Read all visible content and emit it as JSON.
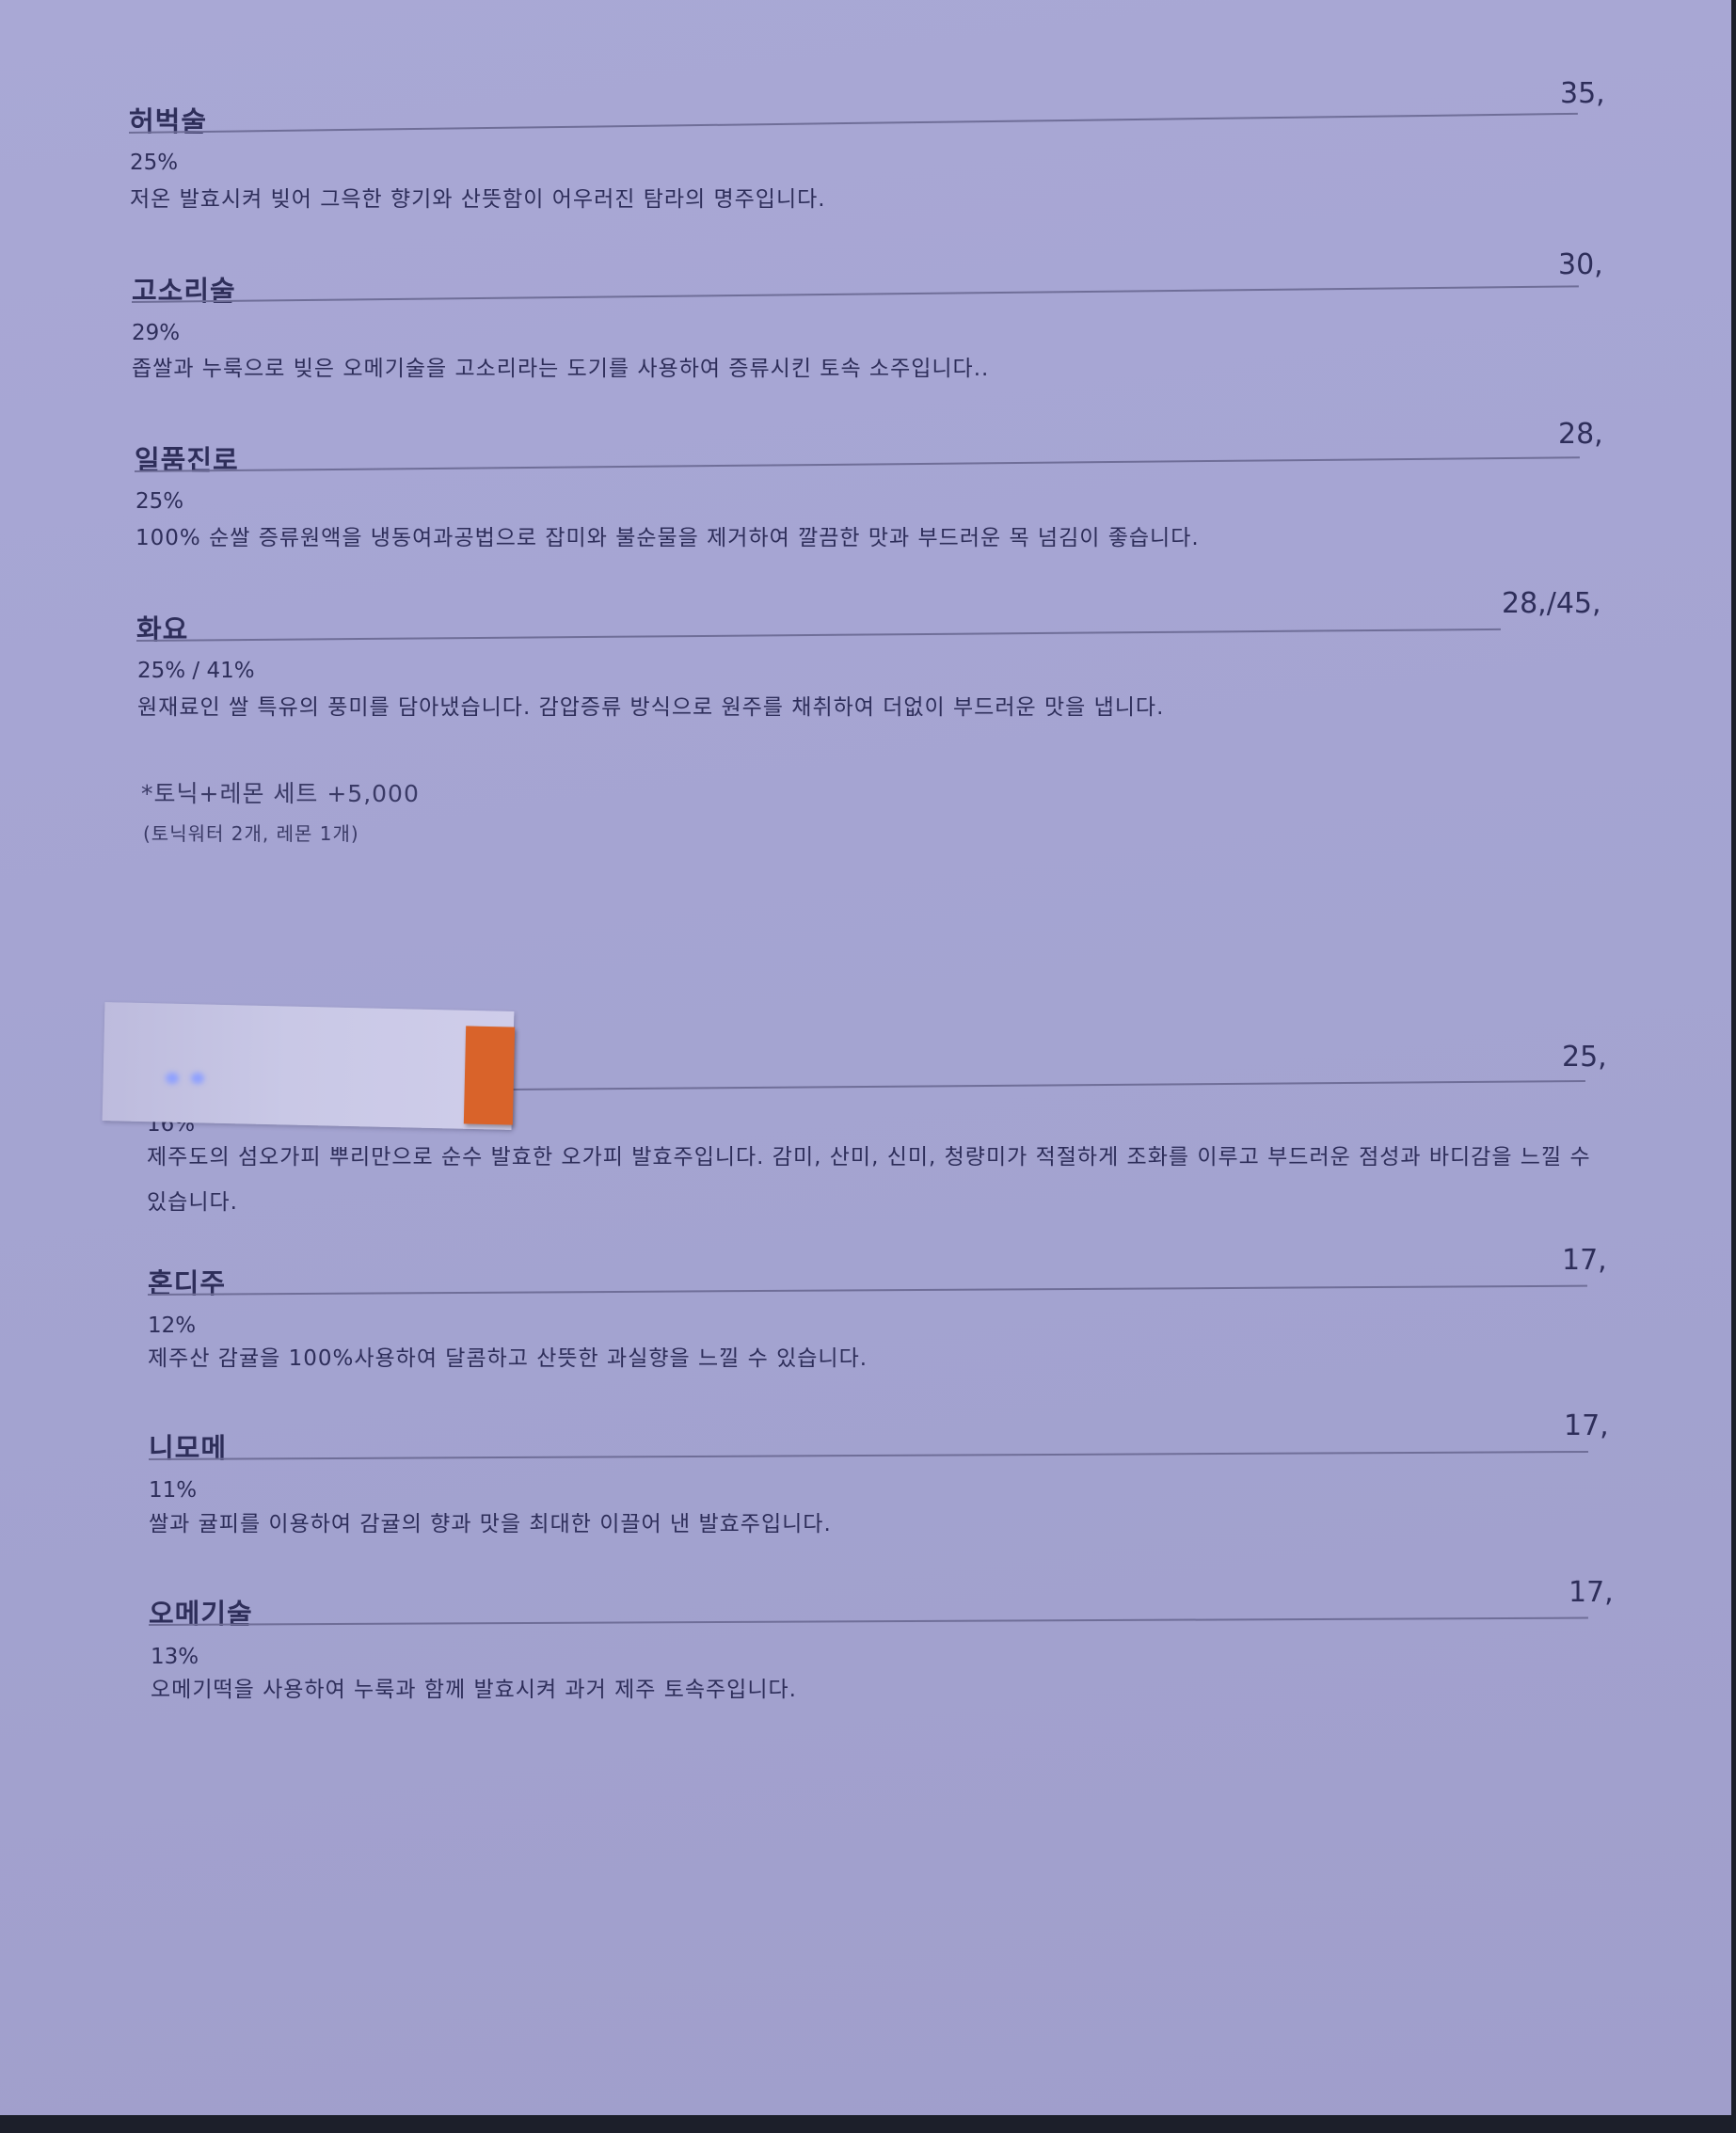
{
  "menu": {
    "items": [
      {
        "name": "허벅술",
        "price": "35,",
        "abv": "25%",
        "description": "저온 발효시켜 빚어 그윽한 향기와 산뜻함이 어우러진 탐라의 명주입니다."
      },
      {
        "name": "고소리술",
        "price": "30,",
        "abv": "29%",
        "description": "좁쌀과 누룩으로 빚은 오메기술을 고소리라는 도기를 사용하여 증류시킨 토속 소주입니다.."
      },
      {
        "name": "일품진로",
        "price": "28,",
        "abv": "25%",
        "description": "100% 순쌀 증류원액을 냉동여과공법으로 잡미와 불순물을 제거하여 깔끔한 맛과 부드러운 목 넘김이 좋습니다."
      },
      {
        "name": "화요",
        "price": "28,/45,",
        "abv": "25% / 41%",
        "description": "원재료인 쌀 특유의 풍미를 담아냈습니다. 감압증류 방식으로 원주를 채취하여 더없이 부드러운 맛을 냅니다."
      },
      {
        "name": "",
        "price": "25,",
        "abv": "16%",
        "description": "제주도의 섬오가피 뿌리만으로 순수 발효한 오가피 발효주입니다. 감미, 산미, 신미, 청량미가 적절하게 조화를 이루고 부드러운 점성과 바디감을 느낄 수 있습니다."
      },
      {
        "name": "혼디주",
        "price": "17,",
        "abv": "12%",
        "description": "제주산 감귤을 100%사용하여 달콤하고 산뜻한 과실향을 느낄 수 있습니다."
      },
      {
        "name": "니모메",
        "price": "17,",
        "abv": "11%",
        "description": "쌀과 귤피를 이용하여 감귤의 향과 맛을 최대한 이끌어 낸 발효주입니다."
      },
      {
        "name": "오메기술",
        "price": "17,",
        "abv": "13%",
        "description": "오메기떡을 사용하여 누룩과 함께 발효시켜 과거 제주 토속주입니다."
      }
    ],
    "tonic_set": {
      "label": "*토닉+레몬 세트 +5,000",
      "note": "(토닉워터 2개, 레몬 1개)"
    },
    "tape_color": "#d9632a"
  }
}
